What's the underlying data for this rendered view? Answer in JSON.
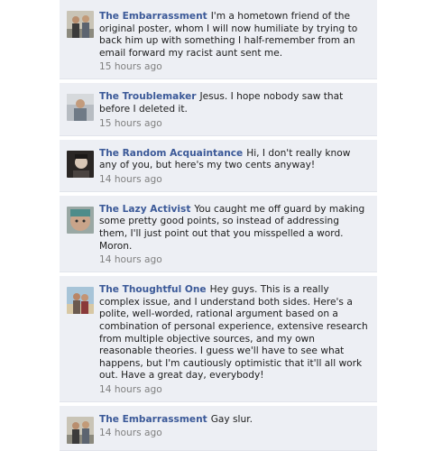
{
  "comments": [
    {
      "author": "The Embarrassment",
      "text": "I'm a hometown friend of the original poster, whom I will now humiliate by trying to back him up with something I half-remember from an email forward my racist aunt sent me.",
      "time": "15 hours ago",
      "avatar": "two-people-photo"
    },
    {
      "author": "The Troublemaker",
      "text": "Jesus. I hope nobody saw that before I deleted it.",
      "time": "15 hours ago",
      "avatar": "person-photo"
    },
    {
      "author": "The Random Acquaintance",
      "text": "Hi, I don't really know any of you, but here's my two cents anyway!",
      "time": "14 hours ago",
      "avatar": "dark-portrait-photo"
    },
    {
      "author": "The Lazy Activist",
      "text": "You caught me off guard by making some pretty good points, so instead of addressing them, I'll just point out that you misspelled a word. Moron.",
      "time": "14 hours ago",
      "avatar": "face-closeup-photo"
    },
    {
      "author": "The Thoughtful One",
      "text": "Hey guys. This is a really complex issue, and I understand both sides. Here's a polite, well-worded, rational argument based on a combination of personal experience, extensive research from multiple objective sources, and my own reasonable theories. I guess we'll have to see what happens, but I'm cautiously optimistic that it'll all work out. Have a great day, everybody!",
      "time": "14 hours ago",
      "avatar": "beach-couple-photo"
    },
    {
      "author": "The Embarrassment",
      "text": "Gay slur.",
      "time": "14 hours ago",
      "avatar": "two-people-photo"
    }
  ]
}
